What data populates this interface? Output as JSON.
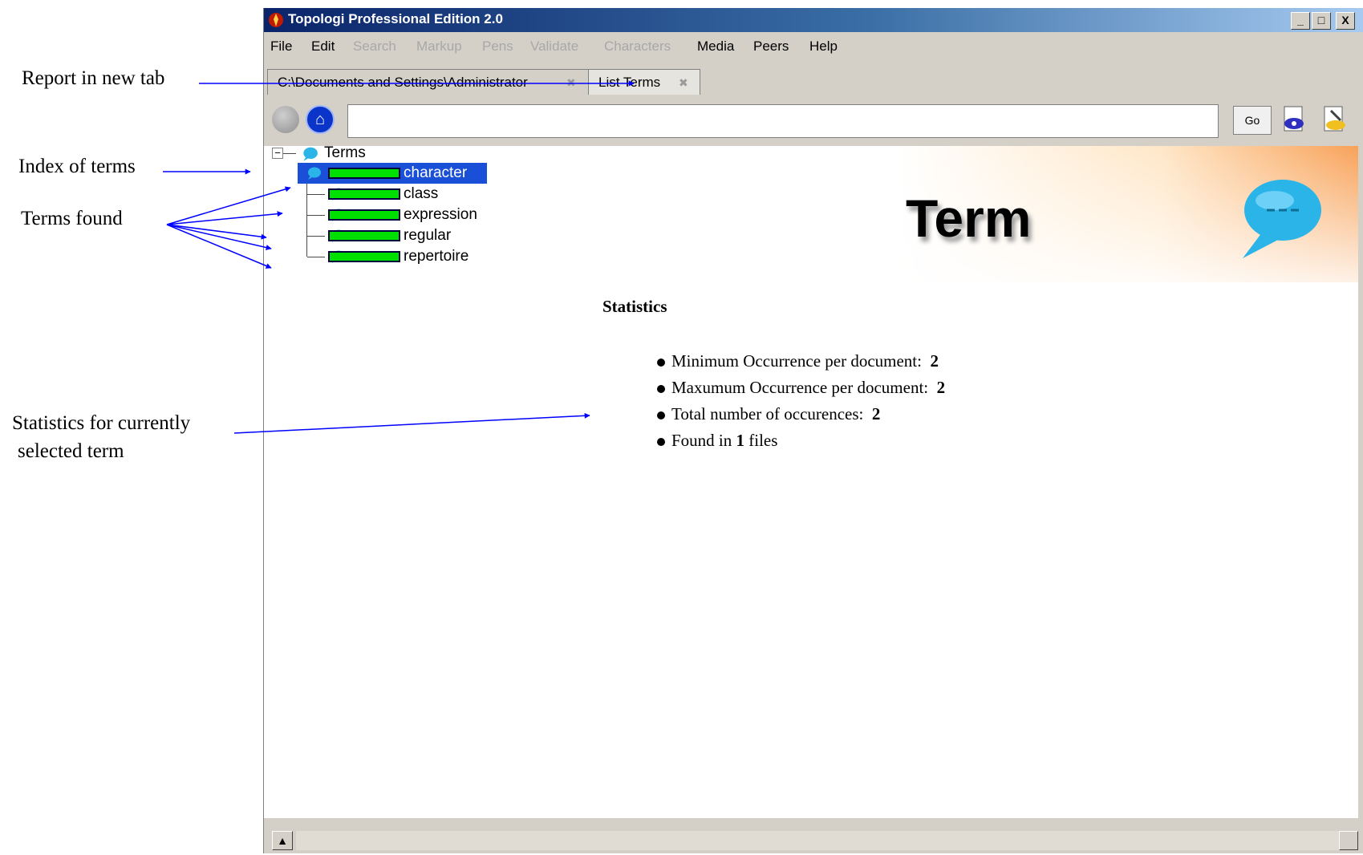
{
  "annotations": {
    "report_tab": "Report in new tab",
    "index_terms": "Index of terms",
    "terms_found": "Terms found",
    "statistics_line1": "Statistics for currently",
    "statistics_line2": "selected term"
  },
  "window": {
    "title": "Topologi Professional Edition 2.0",
    "minimize": "_",
    "maximize": "□",
    "close": "X"
  },
  "menu": {
    "items": [
      {
        "label": "File",
        "enabled": true
      },
      {
        "label": "Edit",
        "enabled": true
      },
      {
        "label": "Search",
        "enabled": false
      },
      {
        "label": "Markup",
        "enabled": false
      },
      {
        "label": "Pens",
        "enabled": false
      },
      {
        "label": "Validate",
        "enabled": false
      },
      {
        "label": "Characters",
        "enabled": false
      },
      {
        "label": "Media",
        "enabled": true
      },
      {
        "label": "Peers",
        "enabled": true
      },
      {
        "label": "Help",
        "enabled": true
      }
    ]
  },
  "tabs": [
    {
      "label": "C:\\Documents and Settings\\Administrator",
      "active": false
    },
    {
      "label": "List Terms",
      "active": true
    }
  ],
  "toolbar": {
    "url_value": "",
    "go_label": "Go",
    "home_glyph": "⌂"
  },
  "banner": {
    "title": "Term"
  },
  "tree": {
    "root_label": "Terms",
    "expander": "−",
    "items": [
      {
        "label": "character",
        "selected": true
      },
      {
        "label": "class",
        "selected": false
      },
      {
        "label": "expression",
        "selected": false
      },
      {
        "label": "regular",
        "selected": false
      },
      {
        "label": "repertoire",
        "selected": false
      }
    ]
  },
  "statistics": {
    "heading": "Statistics",
    "min_label": "Minimum Occurrence per document:",
    "min_value": "2",
    "max_label": "Maxumum Occurrence per document:",
    "max_value": "2",
    "total_label": "Total number of occurences:",
    "total_value": "2",
    "found_prefix": "Found in",
    "found_value": "1",
    "found_suffix": "files"
  },
  "scrollbar": {
    "up_glyph": "▲"
  },
  "colors": {
    "title_bar": "#0a246a",
    "selection": "#1a4fd8",
    "bar_fill": "#00e000",
    "arrow": "#0000ff",
    "banner_accent": "#f8a259",
    "bubble": "#2ab4e8"
  }
}
